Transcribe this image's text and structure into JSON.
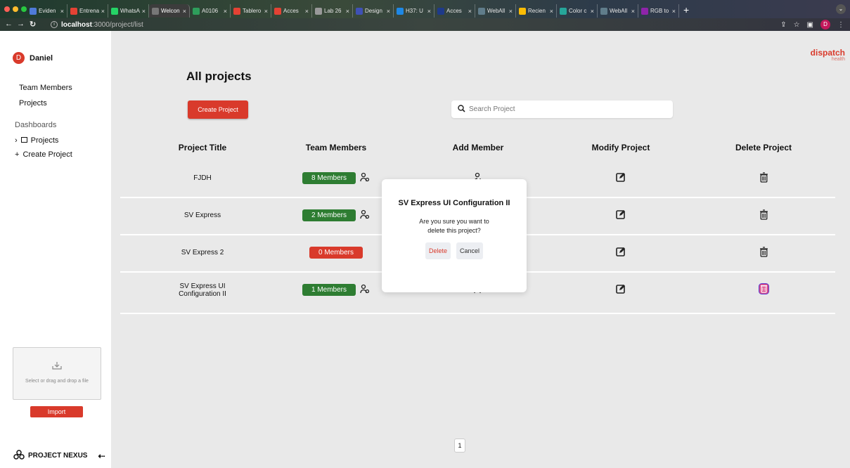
{
  "browser": {
    "tabs": [
      {
        "title": "Eviden",
        "color": "#4f7bd9",
        "active": false
      },
      {
        "title": "Entrena",
        "color": "#e34234",
        "active": false
      },
      {
        "title": "WhatsA",
        "color": "#25d366",
        "active": false
      },
      {
        "title": "Welcon",
        "color": "#777777",
        "active": true
      },
      {
        "title": "A0106",
        "color": "#2e9e5b",
        "active": false
      },
      {
        "title": "Tablero",
        "color": "#e34234",
        "active": false
      },
      {
        "title": "Acces",
        "color": "#e34234",
        "active": false
      },
      {
        "title": "Lab 26",
        "color": "#999999",
        "active": false
      },
      {
        "title": "Design",
        "color": "#3f51b5",
        "active": false
      },
      {
        "title": "H37: U",
        "color": "#1e88e5",
        "active": false
      },
      {
        "title": "Acces",
        "color": "#1e3a8a",
        "active": false
      },
      {
        "title": "WebAll",
        "color": "#607d8b",
        "active": false
      },
      {
        "title": "Recien",
        "color": "#fbbc04",
        "active": false
      },
      {
        "title": "Color c",
        "color": "#26a69a",
        "active": false
      },
      {
        "title": "WebAll",
        "color": "#607d8b",
        "active": false
      },
      {
        "title": "RGB to",
        "color": "#8e24aa",
        "active": false
      }
    ],
    "new_tab": "+",
    "url_host": "localhost",
    "url_path": ":3000/project/list",
    "profile_initial": "D"
  },
  "sidebar": {
    "user_initial": "D",
    "user_name": "Daniel",
    "links": {
      "team_members": "Team Members",
      "projects": "Projects"
    },
    "dashboards_label": "Dashboards",
    "tree_projects": "Projects",
    "tree_create": "Create Project",
    "dropzone_text": "Select or drag and drop a file",
    "import_label": "Import",
    "brand": "PROJECT NEXUS"
  },
  "main": {
    "logo_main": "dispatch",
    "logo_sub": "health",
    "title": "All projects",
    "create_label": "Create Project",
    "search_placeholder": "Search Project",
    "headers": {
      "title": "Project Title",
      "members": "Team Members",
      "add": "Add Member",
      "modify": "Modify Project",
      "delete": "Delete Project"
    },
    "rows": [
      {
        "title": "FJDH",
        "members": "8 Members",
        "status": "green"
      },
      {
        "title": "SV Express",
        "members": "2 Members",
        "status": "green"
      },
      {
        "title": "SV Express 2",
        "members": "0 Members",
        "status": "red"
      },
      {
        "title": "SV Express UI Configuration II",
        "members": "1 Members",
        "status": "green"
      }
    ],
    "page": "1"
  },
  "modal": {
    "title": "SV Express UI Configuration II",
    "message": "Are you sure you want to delete this project?",
    "delete_label": "Delete",
    "cancel_label": "Cancel"
  }
}
